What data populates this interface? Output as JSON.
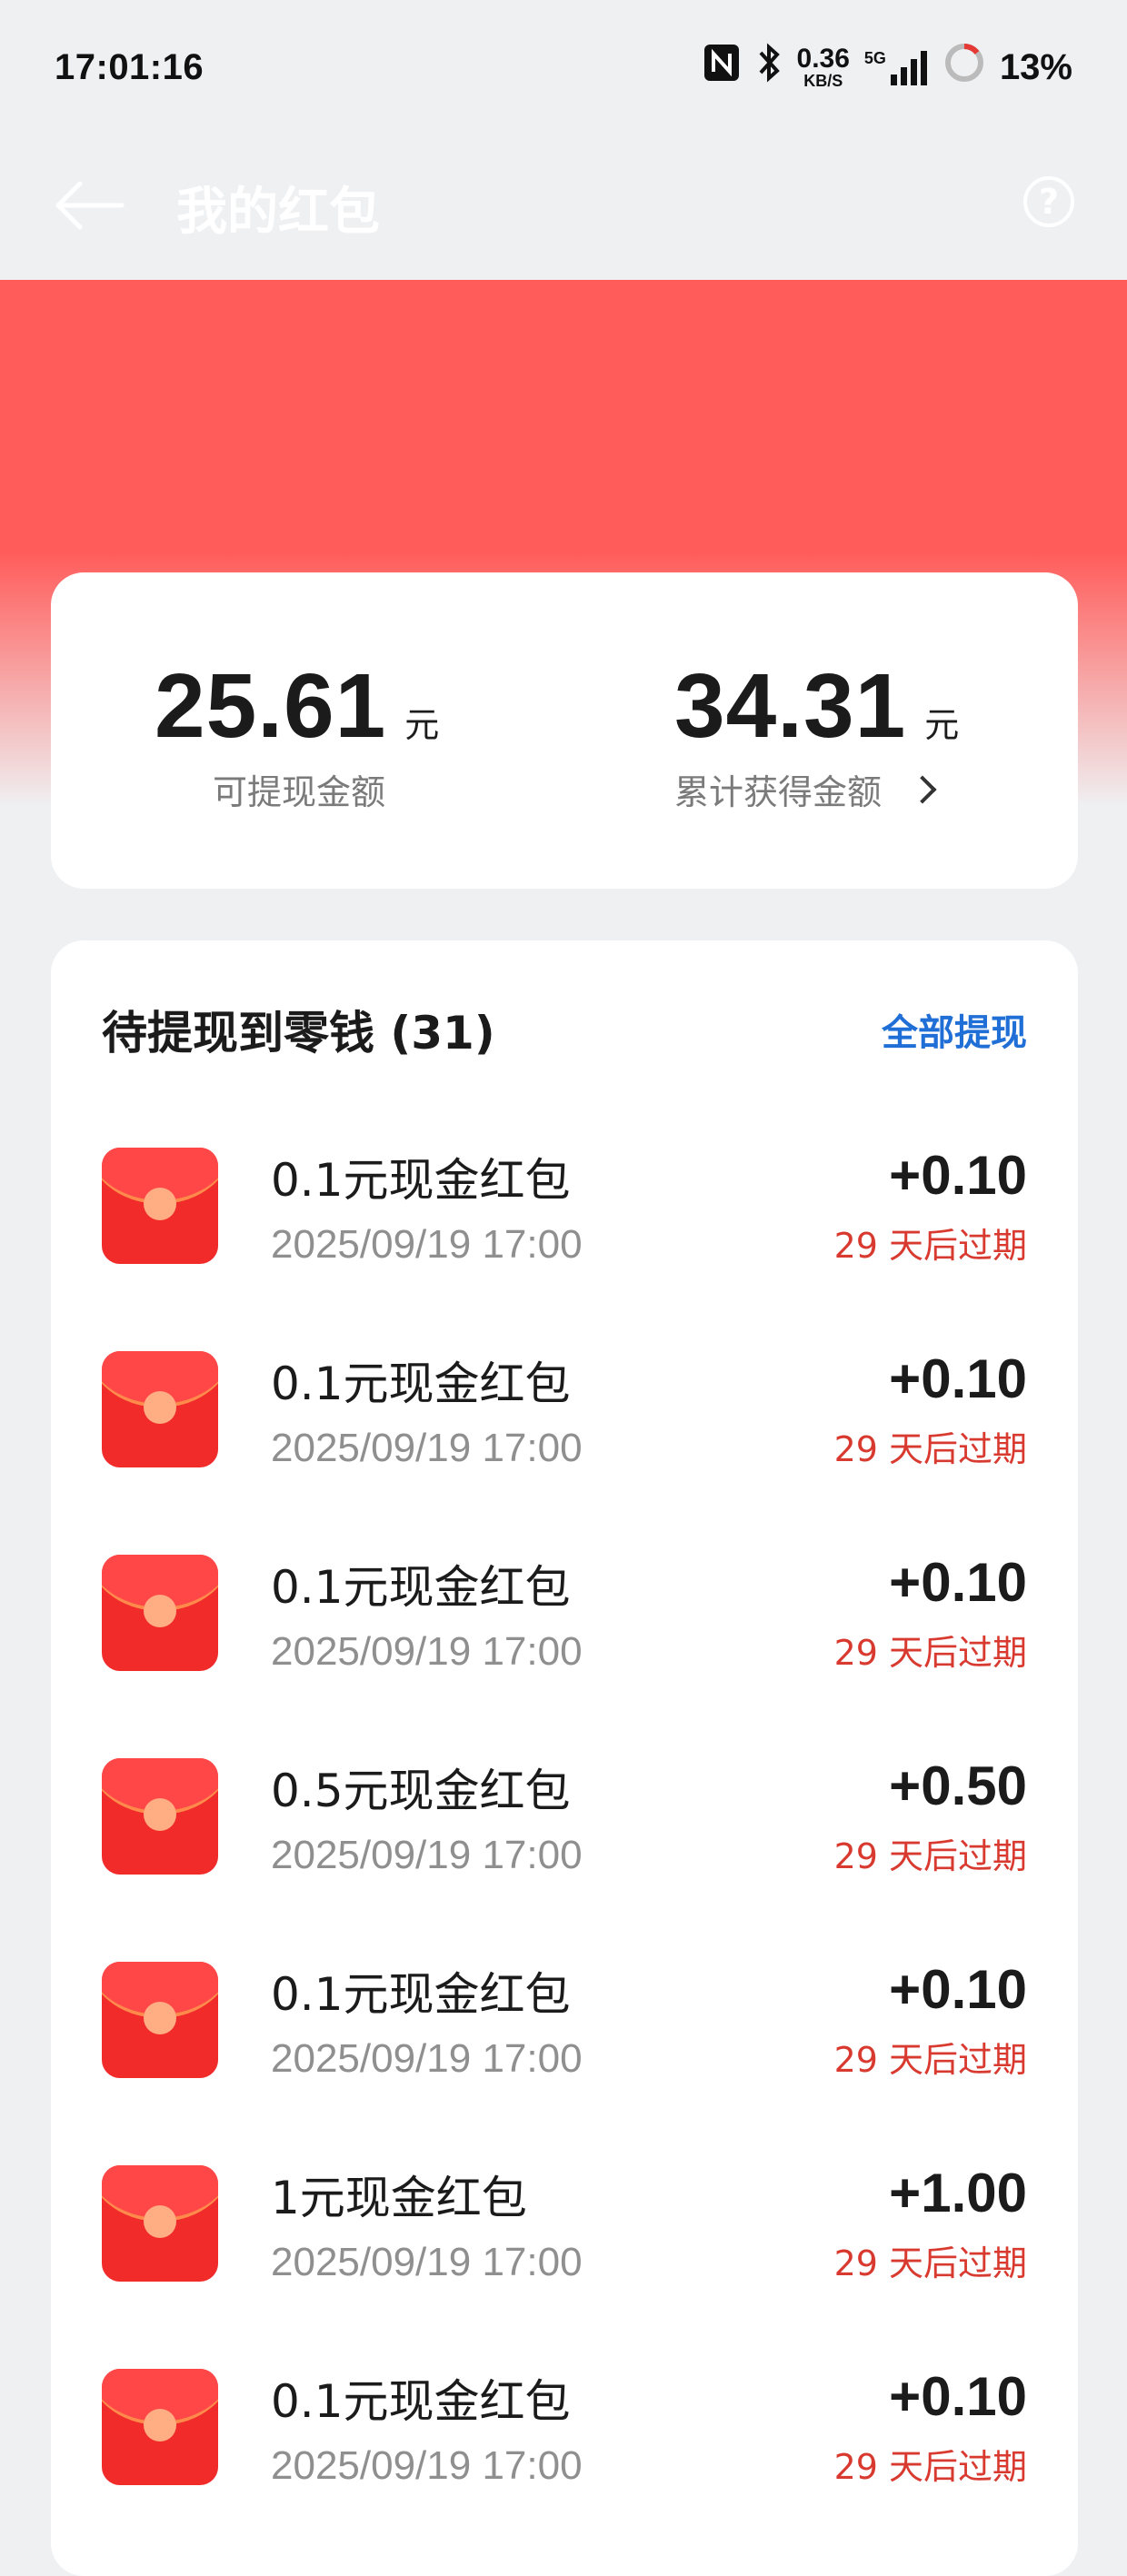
{
  "status_bar": {
    "time": "17:01:16",
    "net_speed_value": "0.36",
    "net_speed_unit": "KB/S",
    "network_label": "5G",
    "battery": "13%"
  },
  "nav": {
    "title": "我的红包",
    "back_icon": "arrow-left-icon",
    "help_icon": "question-circle-icon"
  },
  "summary": {
    "withdrawable_value": "25.61",
    "withdrawable_unit": "元",
    "withdrawable_label": "可提现金额",
    "total_value": "34.31",
    "total_unit": "元",
    "total_label": "累计获得金额"
  },
  "pending": {
    "title": "待提现到零钱 (31)",
    "withdraw_all_label": "全部提现",
    "items": [
      {
        "name": "0.1元现金红包",
        "date": "2025/09/19 17:00",
        "amount": "+0.10",
        "expiry": "29 天后过期"
      },
      {
        "name": "0.1元现金红包",
        "date": "2025/09/19 17:00",
        "amount": "+0.10",
        "expiry": "29 天后过期"
      },
      {
        "name": "0.1元现金红包",
        "date": "2025/09/19 17:00",
        "amount": "+0.10",
        "expiry": "29 天后过期"
      },
      {
        "name": "0.5元现金红包",
        "date": "2025/09/19 17:00",
        "amount": "+0.50",
        "expiry": "29 天后过期"
      },
      {
        "name": "0.1元现金红包",
        "date": "2025/09/19 17:00",
        "amount": "+0.10",
        "expiry": "29 天后过期"
      },
      {
        "name": "1元现金红包",
        "date": "2025/09/19 17:00",
        "amount": "+1.00",
        "expiry": "29 天后过期"
      },
      {
        "name": "0.1元现金红包",
        "date": "2025/09/19 17:00",
        "amount": "+0.10",
        "expiry": "29 天后过期"
      }
    ]
  },
  "colors": {
    "brand_red": "#ff5c5a",
    "expiry_red": "#d93a30",
    "link_blue": "#1f6fd6"
  }
}
